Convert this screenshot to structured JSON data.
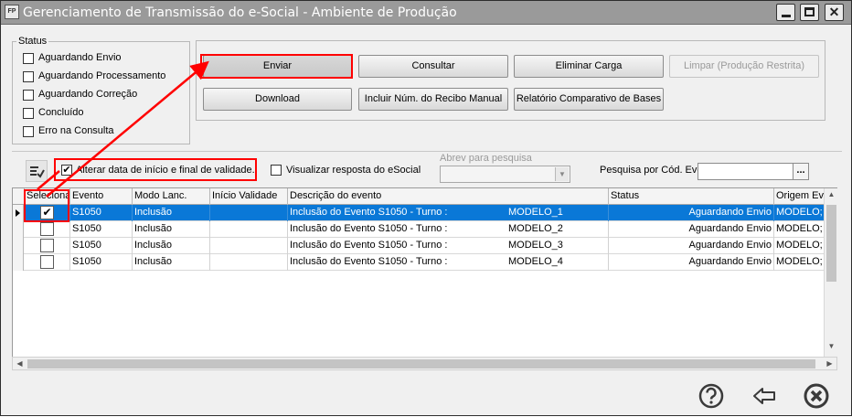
{
  "window": {
    "icon_text": "FP",
    "title": "Gerenciamento de Transmissão do e-Social - Ambiente de Produção"
  },
  "status": {
    "title": "Status",
    "options": [
      "Aguardando Envio",
      "Aguardando Processamento",
      "Aguardando Correção",
      "Concluído",
      "Erro na Consulta"
    ]
  },
  "actions": {
    "enviar": "Enviar",
    "consultar": "Consultar",
    "eliminar": "Eliminar Carga",
    "limpar": "Limpar (Produção Restrita)",
    "download": "Download",
    "incluir": "Incluir Núm. do Recibo Manual",
    "relatorio": "Relatório Comparativo de Bases"
  },
  "filters": {
    "alterar_label": "Alterar data de início e final de validade.",
    "alterar_checked": true,
    "visualizar_label": "Visualizar resposta do eSocial",
    "visualizar_checked": false,
    "abrev_label": "Abrev para pesquisa",
    "abrev_value": "",
    "pesquisa_label": "Pesquisa por Cód. Evento:",
    "pesquisa_value": "",
    "dots": "..."
  },
  "grid": {
    "columns": [
      "Seleciona",
      "Evento",
      "Modo Lanc.",
      "Início Validade",
      "Descrição do evento",
      "Status",
      "Origem Eve"
    ],
    "rows": [
      {
        "checked": true,
        "evento": "S1050",
        "modo": "Inclusão",
        "inicio": "",
        "descricao": "Inclusão do Evento S1050 - Turno :",
        "modelo": "MODELO_1",
        "status": "Aguardando Envio",
        "origem": "MODELO;"
      },
      {
        "checked": false,
        "evento": "S1050",
        "modo": "Inclusão",
        "inicio": "",
        "descricao": "Inclusão do Evento S1050 - Turno :",
        "modelo": "MODELO_2",
        "status": "Aguardando Envio",
        "origem": "MODELO;"
      },
      {
        "checked": false,
        "evento": "S1050",
        "modo": "Inclusão",
        "inicio": "",
        "descricao": "Inclusão do Evento S1050 - Turno :",
        "modelo": "MODELO_3",
        "status": "Aguardando Envio",
        "origem": "MODELO;"
      },
      {
        "checked": false,
        "evento": "S1050",
        "modo": "Inclusão",
        "inicio": "",
        "descricao": "Inclusão do Evento S1050 - Turno :",
        "modelo": "MODELO_4",
        "status": "Aguardando Envio",
        "origem": "MODELO;"
      }
    ]
  },
  "footer": {
    "help_icon": "help-icon",
    "back_icon": "back-arrow-icon",
    "close_icon": "close-icon"
  },
  "colors": {
    "selection": "#0a78d7",
    "annotation": "#ff0000"
  }
}
